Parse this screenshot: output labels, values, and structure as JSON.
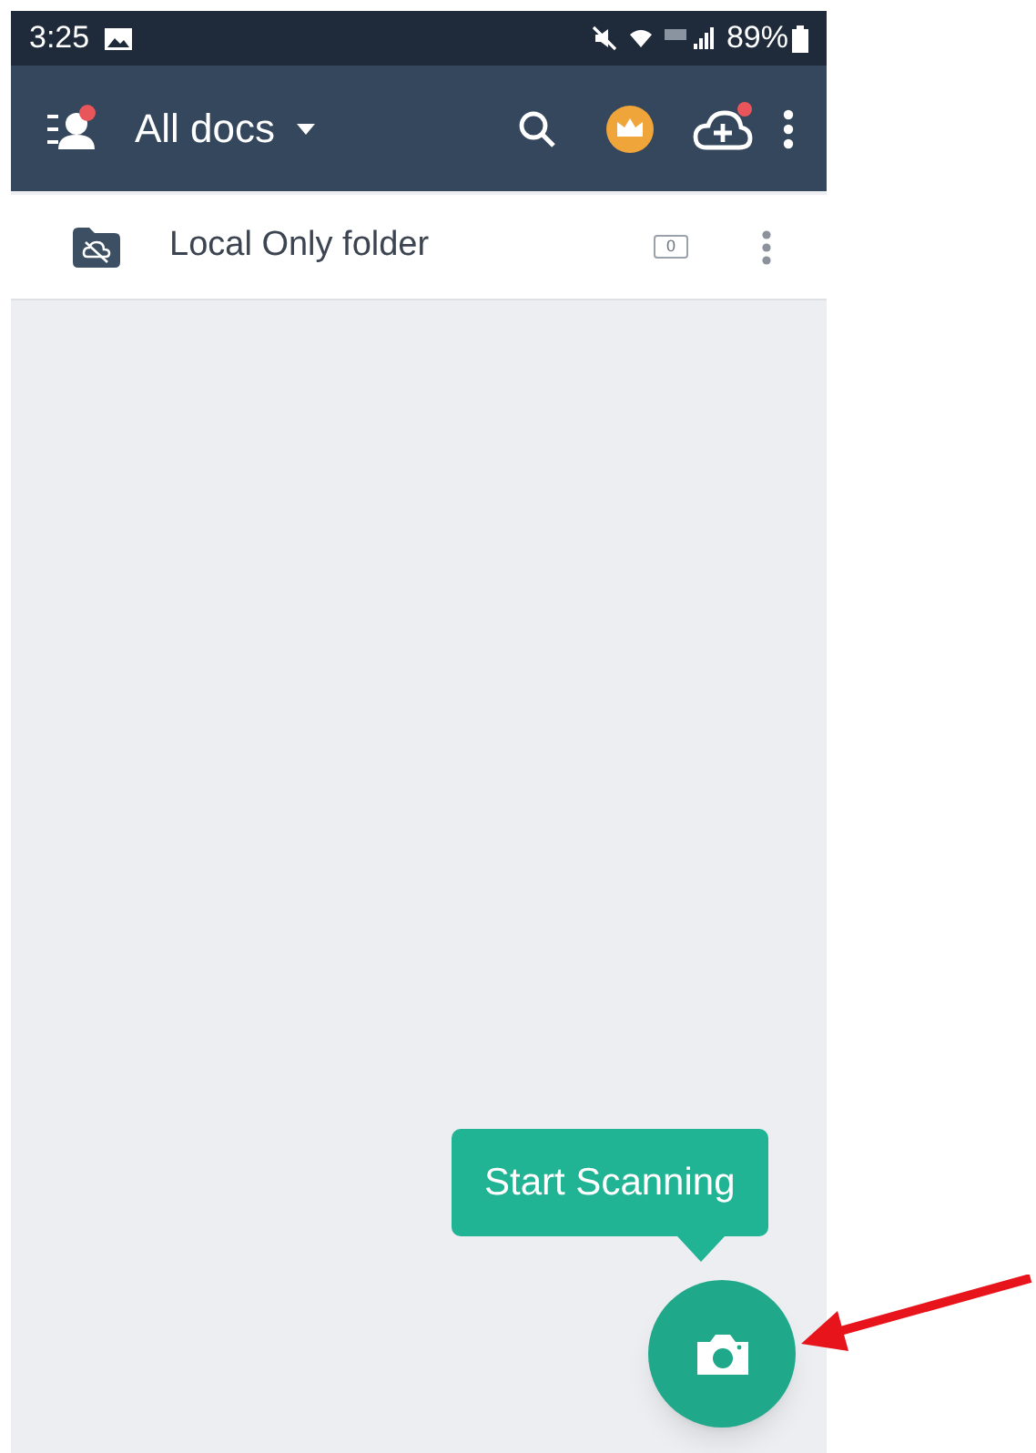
{
  "status_bar": {
    "time": "3:25",
    "battery": "89%"
  },
  "app_bar": {
    "title": "All docs"
  },
  "folders": [
    {
      "name": "Local Only folder",
      "count": "0"
    }
  ],
  "tooltip": {
    "text": "Start Scanning"
  }
}
